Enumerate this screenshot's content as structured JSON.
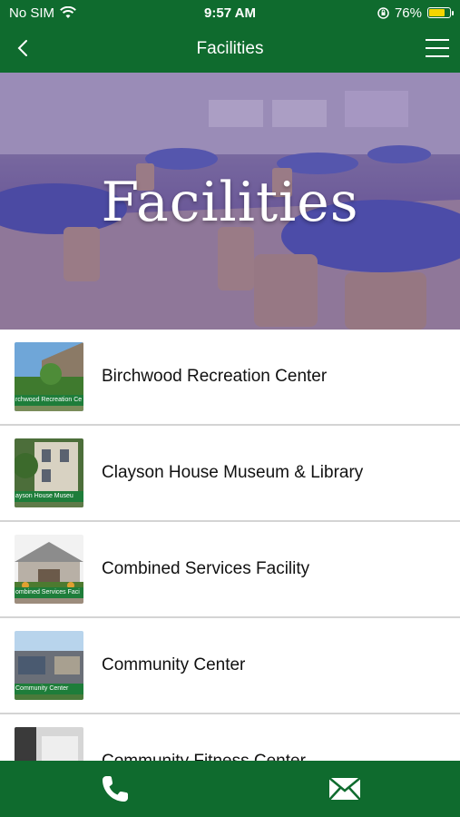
{
  "status": {
    "carrier": "No SIM",
    "time": "9:57 AM",
    "battery": "76%",
    "battery_level": 0.76
  },
  "nav": {
    "title": "Facilities"
  },
  "hero": {
    "title": "Facilities"
  },
  "facilities": [
    {
      "label": "Birchwood Recreation Center",
      "thumb_caption": "rchwood Recreation Ce"
    },
    {
      "label": "Clayson House Museum & Library",
      "thumb_caption": "ayson House Museu"
    },
    {
      "label": "Combined Services Facility",
      "thumb_caption": "ombined Services Faci"
    },
    {
      "label": "Community Center",
      "thumb_caption": "Community Center"
    },
    {
      "label": "Community Fitness Center",
      "thumb_caption": ""
    }
  ],
  "icons": {
    "wifi": "wifi-icon",
    "orientation_lock": "orientation-lock-icon",
    "battery": "battery-icon",
    "back": "chevron-left-icon",
    "menu": "hamburger-menu-icon",
    "phone": "phone-icon",
    "mail": "mail-icon"
  },
  "colors": {
    "brand_green": "#0f6b2e",
    "hero_tint": "#6e5fa0",
    "battery_fill": "#f5d400"
  }
}
